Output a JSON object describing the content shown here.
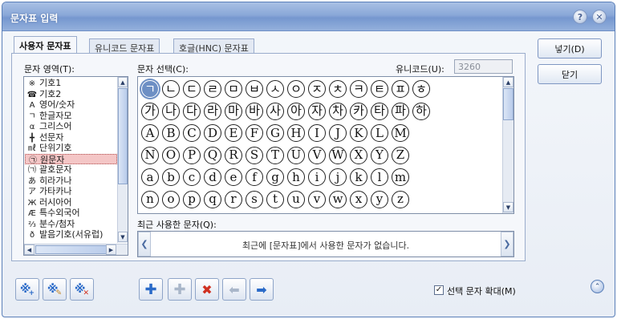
{
  "window": {
    "title": "문자표 입력"
  },
  "tabs": [
    "사용자 문자표",
    "유니코드 문자표",
    "호글(HNC) 문자표"
  ],
  "labels": {
    "area": "문자 영역(T):",
    "select": "문자 선택(C):",
    "unicode": "유니코드(U):",
    "recent": "최근 사용한 문자(Q):",
    "expand": "선택 문자 확대(M)"
  },
  "unicode_value": "3260",
  "buttons": {
    "insert": "넣기(D)",
    "close": "닫기"
  },
  "categories": [
    {
      "icon": "※",
      "label": "기호1"
    },
    {
      "icon": "☎",
      "label": "기호2"
    },
    {
      "icon": "A",
      "label": "영어/숫자"
    },
    {
      "icon": "ㄱ",
      "label": "한글자모"
    },
    {
      "icon": "α",
      "label": "그리스어"
    },
    {
      "icon": "╋",
      "label": "선문자"
    },
    {
      "icon": "㎖",
      "label": "단위기호"
    },
    {
      "icon": "㉠",
      "label": "원문자"
    },
    {
      "icon": "㈀",
      "label": "괄호문자"
    },
    {
      "icon": "あ",
      "label": "히라가나"
    },
    {
      "icon": "ア",
      "label": "가타카나"
    },
    {
      "icon": "Ж",
      "label": "러시아어"
    },
    {
      "icon": "Æ",
      "label": "특수외국어"
    },
    {
      "icon": "⅔",
      "label": "분수/첨자"
    },
    {
      "icon": "ð",
      "label": "발음기호(서유럽)"
    }
  ],
  "selected_category": "원문자",
  "char_rows": [
    [
      "ㄱ",
      "ㄴ",
      "ㄷ",
      "ㄹ",
      "ㅁ",
      "ㅂ",
      "ㅅ",
      "ㅇ",
      "ㅈ",
      "ㅊ",
      "ㅋ",
      "ㅌ",
      "ㅍ",
      "ㅎ"
    ],
    [
      "가",
      "나",
      "다",
      "라",
      "마",
      "바",
      "사",
      "아",
      "자",
      "차",
      "카",
      "타",
      "파",
      "하"
    ],
    [
      "A",
      "B",
      "C",
      "D",
      "E",
      "F",
      "G",
      "H",
      "I",
      "J",
      "K",
      "L",
      "M"
    ],
    [
      "N",
      "O",
      "P",
      "Q",
      "R",
      "S",
      "T",
      "U",
      "V",
      "W",
      "X",
      "Y",
      "Z"
    ],
    [
      "a",
      "b",
      "c",
      "d",
      "e",
      "f",
      "g",
      "h",
      "i",
      "j",
      "k",
      "l",
      "m"
    ],
    [
      "n",
      "o",
      "p",
      "q",
      "r",
      "s",
      "t",
      "u",
      "v",
      "w",
      "x",
      "y",
      "z"
    ]
  ],
  "recent_empty_text": "최근에 [문자표]에서 사용한 문자가 없습니다.",
  "bottom_tools": [
    "add-set-icon",
    "edit-set-icon",
    "delete-set-icon"
  ],
  "edit_tools": [
    "add-icon",
    "add-disabled-icon",
    "delete-icon",
    "arrow-left-icon",
    "arrow-right-icon"
  ],
  "colors": {
    "title_bar": "#8aa8d8",
    "selected_cell": "#6d8fc4",
    "selected_row": "#f4c6c6",
    "delete_red": "#d03020",
    "plus_blue": "#2a6ac8"
  }
}
